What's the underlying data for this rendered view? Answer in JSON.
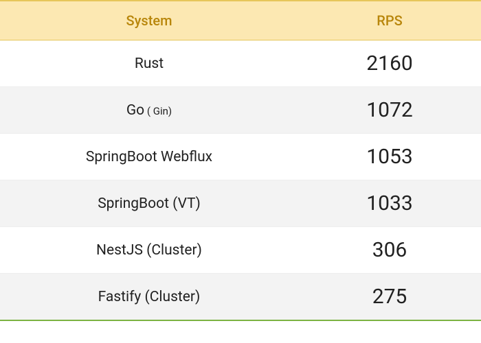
{
  "header": {
    "system_label": "System",
    "rps_label": "RPS"
  },
  "rows": [
    {
      "system": "Rust",
      "rps": "2160"
    },
    {
      "system": "Go",
      "suffix": " ( Gin)",
      "rps": "1072"
    },
    {
      "system": "SpringBoot Webflux",
      "rps": "1053"
    },
    {
      "system": "SpringBoot (VT)",
      "rps": "1033"
    },
    {
      "system": "NestJS (Cluster)",
      "rps": "306"
    },
    {
      "system": "Fastify (Cluster)",
      "rps": "275"
    }
  ],
  "chart_data": {
    "type": "table",
    "title": "",
    "columns": [
      "System",
      "RPS"
    ],
    "data": [
      [
        "Rust",
        2160
      ],
      [
        "Go ( Gin)",
        1072
      ],
      [
        "SpringBoot Webflux",
        1053
      ],
      [
        "SpringBoot (VT)",
        1033
      ],
      [
        "NestJS (Cluster)",
        306
      ],
      [
        "Fastify (Cluster)",
        275
      ]
    ]
  }
}
